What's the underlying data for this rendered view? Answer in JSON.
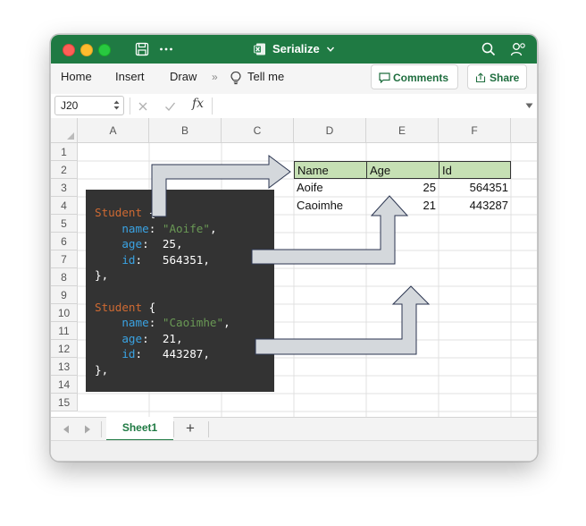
{
  "window": {
    "title": "Serialize"
  },
  "ribbon": {
    "tabs": [
      "Home",
      "Insert",
      "Draw"
    ],
    "tell_me": "Tell me",
    "comments_label": "Comments",
    "share_label": "Share"
  },
  "formula_bar": {
    "name_box": "J20",
    "fx": "fx",
    "formula": ""
  },
  "grid": {
    "columns": [
      "A",
      "B",
      "C",
      "D",
      "E",
      "F"
    ],
    "rows": [
      "1",
      "2",
      "3",
      "4",
      "5",
      "6",
      "7",
      "8",
      "9",
      "10",
      "11",
      "12",
      "13",
      "14",
      "15"
    ],
    "table": {
      "headers": [
        "Name",
        "Age",
        "Id"
      ],
      "rows": [
        [
          "Aoife",
          "25",
          "564351"
        ],
        [
          "Caoimhe",
          "21",
          "443287"
        ]
      ]
    }
  },
  "code": {
    "records": [
      {
        "type": "Student",
        "name": "\"Aoife\"",
        "age": "25",
        "id": "564351"
      },
      {
        "type": "Student",
        "name": "\"Caoimhe\"",
        "age": "21",
        "id": "443287"
      }
    ],
    "keys": {
      "name": "name",
      "age": "age",
      "id": "id"
    }
  },
  "sheets": {
    "tabs": [
      "Sheet1"
    ],
    "add": "+"
  },
  "colors": {
    "accent": "#1f7a43",
    "header_fill": "#c6e0b4",
    "code_bg": "#333333",
    "keyword": "#cf6a33",
    "property": "#3aa3e3",
    "string": "#6a9955",
    "arrow_fill": "#d4d8dc"
  }
}
